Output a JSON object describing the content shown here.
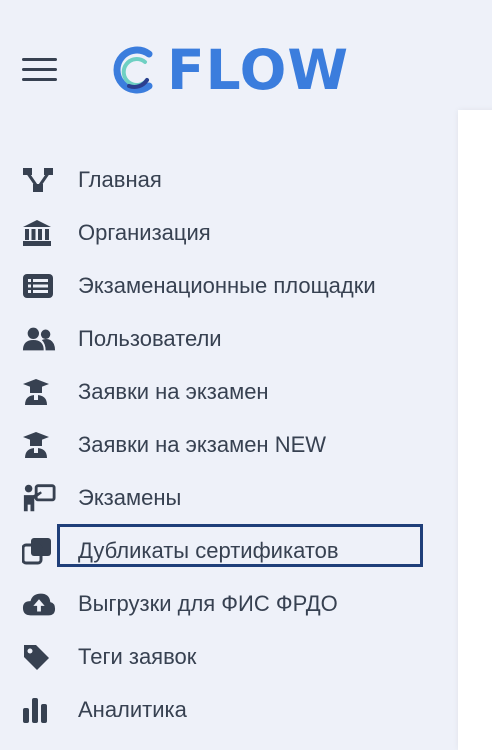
{
  "brand": {
    "name": "FLOW",
    "color": "#3b7ddd"
  },
  "menu_toggle": {
    "icon": "hamburger-icon"
  },
  "nav": {
    "items": [
      {
        "label": "Главная",
        "icon": "hierarchy-icon"
      },
      {
        "label": "Организация",
        "icon": "bank-icon"
      },
      {
        "label": "Экзаменационные площадки",
        "icon": "list-icon"
      },
      {
        "label": "Пользователи",
        "icon": "users-icon"
      },
      {
        "label": "Заявки на экзамен",
        "icon": "graduate-icon"
      },
      {
        "label": "Заявки на экзамен NEW",
        "icon": "graduate-icon"
      },
      {
        "label": "Экзамены",
        "icon": "teacher-board-icon"
      },
      {
        "label": "Дубликаты сертификатов",
        "icon": "copy-icon",
        "selected": true
      },
      {
        "label": "Выгрузки для ФИС ФРДО",
        "icon": "cloud-upload-icon"
      },
      {
        "label": "Теги заявок",
        "icon": "tag-icon"
      },
      {
        "label": "Аналитика",
        "icon": "bar-chart-icon"
      }
    ]
  },
  "colors": {
    "sidebar_bg": "#eef1f9",
    "icon": "#374151",
    "text": "#374151",
    "selection_border": "#1f3f7a"
  }
}
